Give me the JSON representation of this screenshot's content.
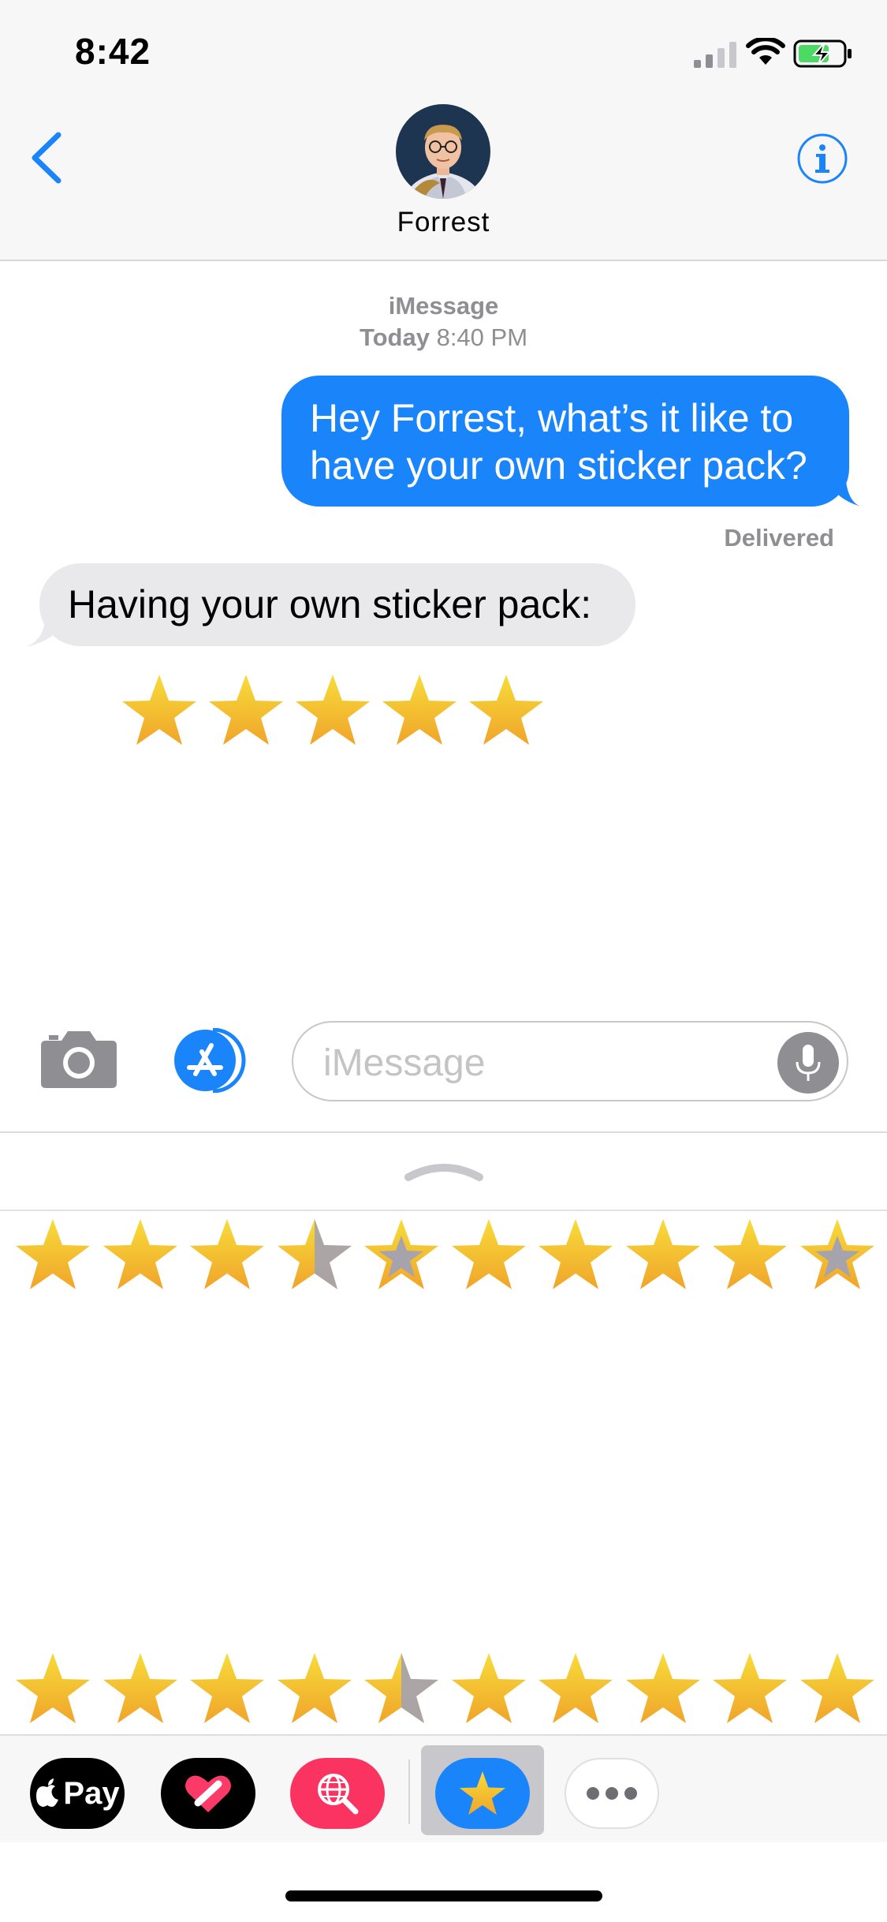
{
  "status_bar": {
    "time": "8:42"
  },
  "header": {
    "contact_name": "Forrest"
  },
  "conversation": {
    "service": "iMessage",
    "day": "Today",
    "time": "8:40 PM",
    "messages": [
      {
        "direction": "outgoing",
        "lines": [
          "Hey Forrest, what’s it like to",
          "have your own sticker pack?"
        ]
      },
      {
        "direction": "incoming",
        "text": "Having your own sticker pack:"
      }
    ],
    "delivery_status": "Delivered",
    "sticker_rating": 5
  },
  "input_bar": {
    "placeholder": "iMessage"
  },
  "sticker_drawer": {
    "row1_ratings": [
      1,
      1,
      1,
      0.5,
      0,
      1,
      1,
      1,
      1,
      0
    ],
    "row2_ratings": [
      1,
      1,
      1,
      1,
      0.5,
      1,
      1,
      1,
      1,
      1
    ]
  },
  "app_strip": {
    "apple_pay_label": "Pay",
    "apps": [
      "apple-pay",
      "digital-touch",
      "image-search",
      "star-stickers",
      "more"
    ],
    "selected_app": "star-stickers"
  },
  "colors": {
    "accent_blue": "#1a84fb",
    "star_gold": "#f5b821",
    "star_empty": "#a7a3ad",
    "incoming_bubble": "#e9e9eb"
  }
}
